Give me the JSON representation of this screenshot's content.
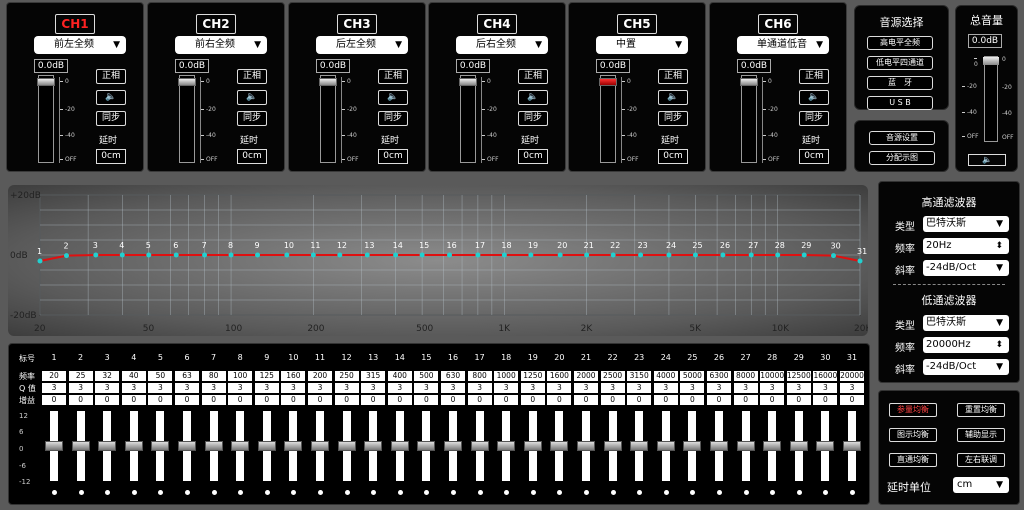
{
  "channels": [
    {
      "title": "CH1",
      "active": true,
      "source": "前左全频",
      "gain": "0.0dB",
      "phase": "正相",
      "mute_icon": "speaker-icon",
      "sync": "同步",
      "delay_label": "延时",
      "delay": "0cm",
      "knob": 0
    },
    {
      "title": "CH2",
      "active": false,
      "source": "前右全频",
      "gain": "0.0dB",
      "phase": "正相",
      "mute_icon": "speaker-icon",
      "sync": "同步",
      "delay_label": "延时",
      "delay": "0cm",
      "knob": 0
    },
    {
      "title": "CH3",
      "active": false,
      "source": "后左全频",
      "gain": "0.0dB",
      "phase": "正相",
      "mute_icon": "speaker-icon",
      "sync": "同步",
      "delay_label": "延时",
      "delay": "0cm",
      "knob": 0
    },
    {
      "title": "CH4",
      "active": false,
      "source": "后右全频",
      "gain": "0.0dB",
      "phase": "正相",
      "mute_icon": "speaker-icon",
      "sync": "同步",
      "delay_label": "延时",
      "delay": "0cm",
      "knob": 0
    },
    {
      "title": "CH5",
      "active": false,
      "source": "中置",
      "gain": "0.0dB",
      "phase": "正相",
      "mute_icon": "speaker-icon",
      "sync": "同步",
      "delay_label": "延时",
      "delay": "0cm",
      "knob": 0,
      "knob_red": true
    },
    {
      "title": "CH6",
      "active": false,
      "source": "单通道低音",
      "gain": "0.0dB",
      "phase": "正相",
      "mute_icon": "speaker-icon",
      "sync": "同步",
      "delay_label": "延时",
      "delay": "0cm",
      "knob": 0
    }
  ],
  "fader_ticks": [
    "0",
    "-20",
    "-40",
    "OFF"
  ],
  "source_select": {
    "title": "音源选择",
    "buttons": [
      "高电平全频",
      "低电平四通道",
      "蓝　牙",
      "U S B"
    ]
  },
  "setup": {
    "buttons": [
      "音源设置",
      "分配示图"
    ]
  },
  "master": {
    "title": "总音量",
    "gain": "0.0dB",
    "ticks": [
      "0",
      "-20",
      "-40",
      "OFF"
    ],
    "mute_icon": "speaker-icon"
  },
  "graph": {
    "y_labels": [
      "+20dB",
      "0dB",
      "-20dB"
    ],
    "x_labels": [
      "20",
      "50",
      "100",
      "200",
      "500",
      "1K",
      "2K",
      "5K",
      "10K",
      "20K"
    ],
    "curve_color": "#e01010",
    "point_color": "#22d0d0"
  },
  "chart_data": {
    "type": "line",
    "title": "",
    "x_scale": "log",
    "xlim": [
      20,
      20000
    ],
    "ylim": [
      -20,
      20
    ],
    "x": [
      20,
      25,
      32,
      40,
      50,
      63,
      80,
      100,
      125,
      160,
      200,
      250,
      315,
      400,
      500,
      630,
      800,
      1000,
      1250,
      1600,
      2000,
      2500,
      3150,
      4000,
      5000,
      6300,
      8000,
      10000,
      12500,
      16000,
      20000
    ],
    "series": [
      {
        "values": [
          -2,
          -0.2,
          0,
          0,
          0,
          0,
          0,
          0,
          0,
          0,
          0,
          0,
          0,
          0,
          0,
          0,
          0,
          0,
          0,
          0,
          0,
          0,
          0,
          0,
          0,
          0,
          0,
          0,
          0,
          -0.2,
          -2
        ]
      }
    ],
    "point_labels": [
      "1",
      "2",
      "3",
      "4",
      "5",
      "6",
      "7",
      "8",
      "9",
      "10",
      "11",
      "12",
      "13",
      "14",
      "15",
      "16",
      "17",
      "18",
      "19",
      "20",
      "21",
      "22",
      "23",
      "24",
      "25",
      "26",
      "27",
      "28",
      "29",
      "30",
      "31"
    ]
  },
  "eq_table": {
    "row_labels": [
      "标号",
      "频率",
      "Q 值",
      "增益"
    ],
    "bands": [
      "1",
      "2",
      "3",
      "4",
      "5",
      "6",
      "7",
      "8",
      "9",
      "10",
      "11",
      "12",
      "13",
      "14",
      "15",
      "16",
      "17",
      "18",
      "19",
      "20",
      "21",
      "22",
      "23",
      "24",
      "25",
      "26",
      "27",
      "28",
      "29",
      "30",
      "31"
    ],
    "freqs": [
      "20",
      "25",
      "32",
      "40",
      "50",
      "63",
      "80",
      "100",
      "125",
      "160",
      "200",
      "250",
      "315",
      "400",
      "500",
      "630",
      "800",
      "1000",
      "1250",
      "1600",
      "2000",
      "2500",
      "3150",
      "4000",
      "5000",
      "6300",
      "8000",
      "10000",
      "12500",
      "16000",
      "20000"
    ],
    "q": [
      "3",
      "3",
      "3",
      "3",
      "3",
      "3",
      "3",
      "3",
      "3",
      "3",
      "3",
      "3",
      "3",
      "3",
      "3",
      "3",
      "3",
      "3",
      "3",
      "3",
      "3",
      "3",
      "3",
      "3",
      "3",
      "3",
      "3",
      "3",
      "3",
      "3",
      "3"
    ],
    "gain": [
      "0",
      "0",
      "0",
      "0",
      "0",
      "0",
      "0",
      "0",
      "0",
      "0",
      "0",
      "0",
      "0",
      "0",
      "0",
      "0",
      "0",
      "0",
      "0",
      "0",
      "0",
      "0",
      "0",
      "0",
      "0",
      "0",
      "0",
      "0",
      "0",
      "0",
      "0"
    ],
    "scale": [
      "12",
      "6",
      "0",
      "-6",
      "-12"
    ]
  },
  "high_pass": {
    "title": "高通滤波器",
    "type_label": "类型",
    "type": "巴特沃斯",
    "freq_label": "频率",
    "freq": "20Hz",
    "slope_label": "斜率",
    "slope": "-24dB/Oct"
  },
  "low_pass": {
    "title": "低通滤波器",
    "type_label": "类型",
    "type": "巴特沃斯",
    "freq_label": "频率",
    "freq": "20000Hz",
    "slope_label": "斜率",
    "slope": "-24dB/Oct"
  },
  "actions": {
    "param_eq": "参量均衡",
    "reset_eq": "重置均衡",
    "graphic_eq": "图示均衡",
    "aux_display": "辅助显示",
    "pass_eq": "直通均衡",
    "lr_link": "左右联调",
    "delay_unit_label": "延时单位",
    "delay_unit": "cm"
  }
}
